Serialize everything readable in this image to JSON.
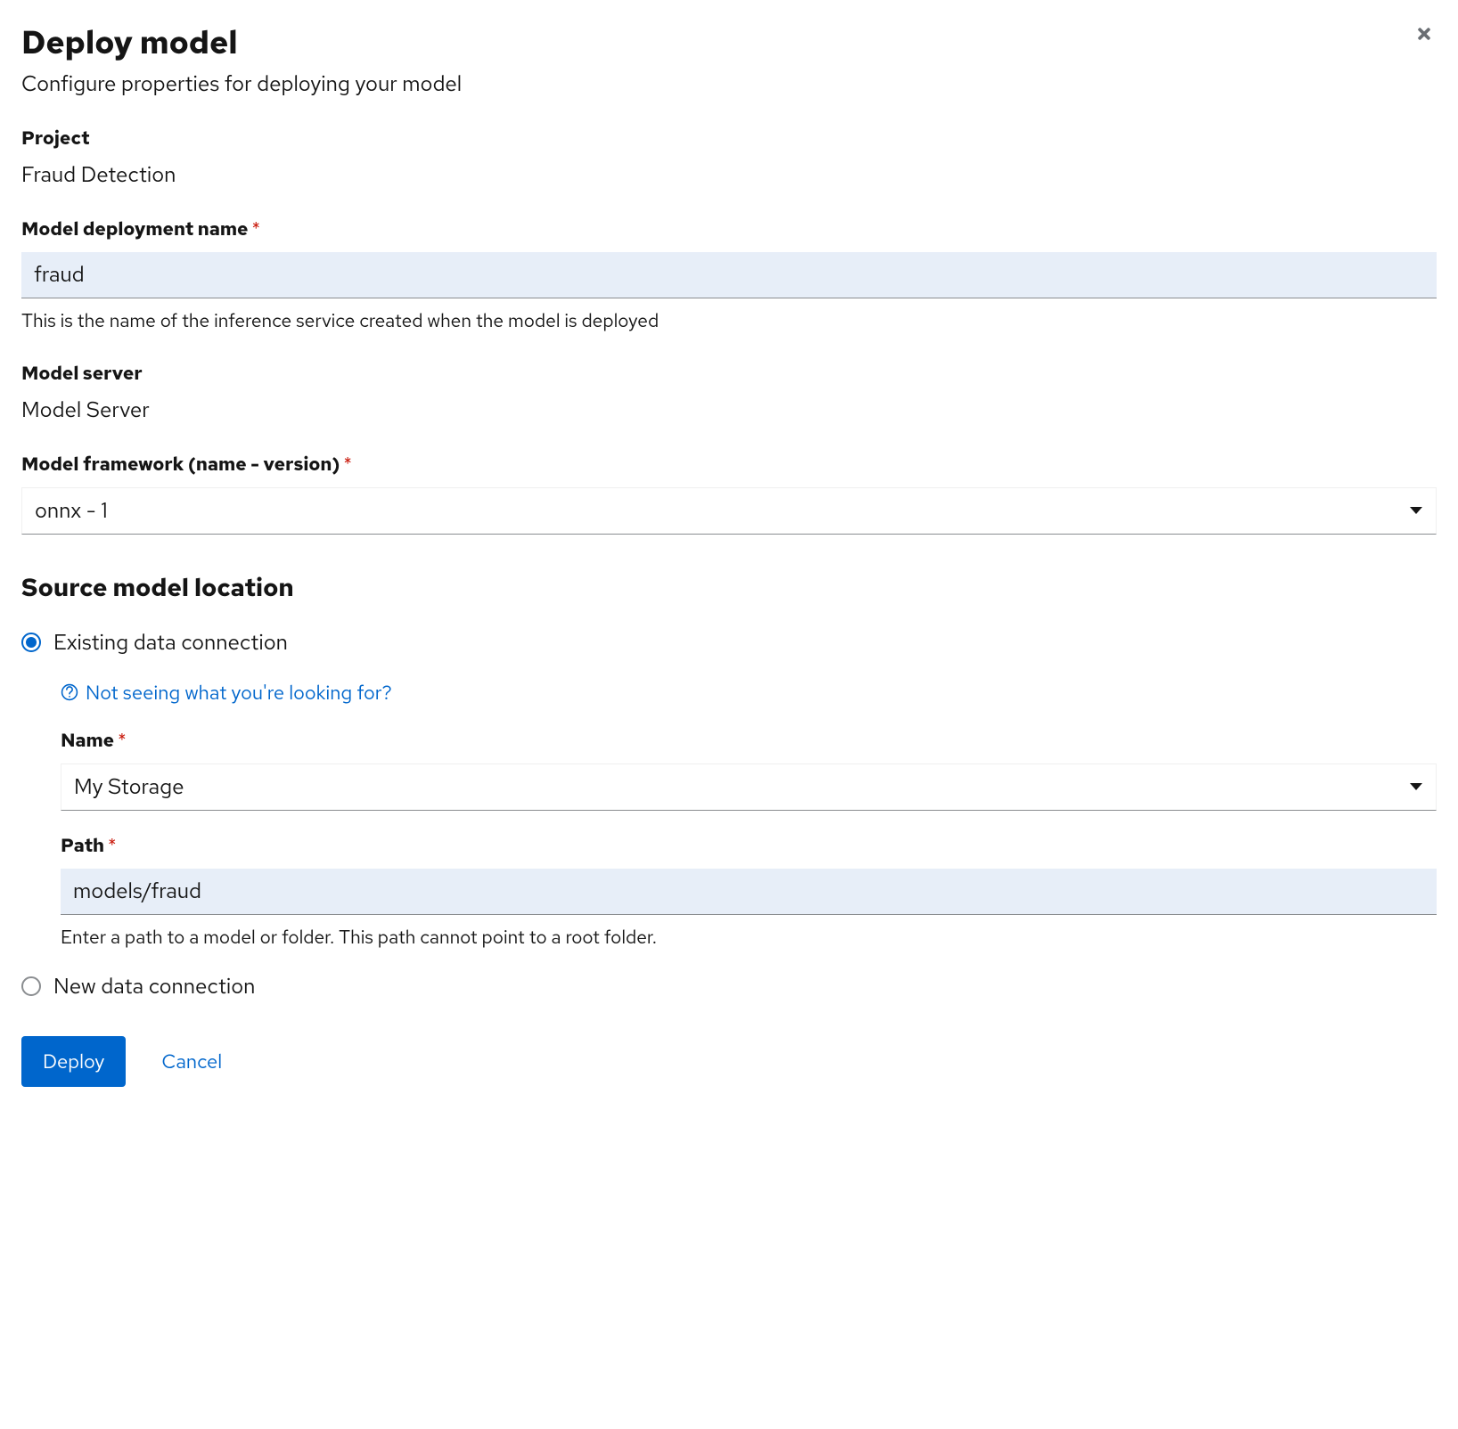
{
  "modal": {
    "title": "Deploy model",
    "subtitle": "Configure properties for deploying your model"
  },
  "project": {
    "label": "Project",
    "value": "Fraud Detection"
  },
  "deployment_name": {
    "label": "Model deployment name",
    "value": "fraud",
    "helper": "This is the name of the inference service created when the model is deployed"
  },
  "model_server": {
    "label": "Model server",
    "value": "Model Server"
  },
  "framework": {
    "label": "Model framework (name - version)",
    "selected": "onnx - 1"
  },
  "source": {
    "heading": "Source model location",
    "options": {
      "existing": "Existing data connection",
      "new": "New data connection"
    },
    "help_link": "Not seeing what you're looking for?",
    "name": {
      "label": "Name",
      "selected": "My Storage"
    },
    "path": {
      "label": "Path",
      "value": "models/fraud",
      "helper": "Enter a path to a model or folder. This path cannot point to a root folder."
    }
  },
  "footer": {
    "deploy": "Deploy",
    "cancel": "Cancel"
  }
}
